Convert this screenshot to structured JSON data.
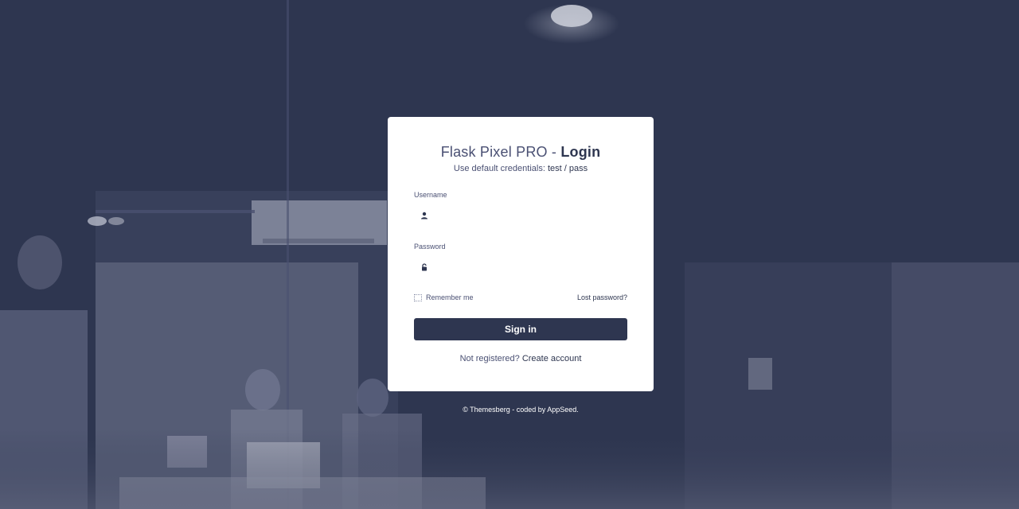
{
  "login": {
    "title_prefix": "Flask Pixel PRO - ",
    "title_strong": "Login",
    "subtitle_prefix": "Use default credentials: ",
    "subtitle_credentials": "test / pass",
    "username_label": "Username",
    "username_placeholder": "",
    "password_label": "Password",
    "password_placeholder": "",
    "remember_label": "Remember me",
    "lost_password_label": "Lost password?",
    "signin_label": "Sign in",
    "register_prompt": "Not registered? ",
    "register_link": "Create account"
  },
  "footer": {
    "copyright": "© Themesberg",
    "separator": " - coded by ",
    "author": "AppSeed",
    "end": "."
  },
  "icons": {
    "username": "user-icon",
    "password": "unlock-icon"
  },
  "colors": {
    "primary": "#2e3650",
    "text": "#4a5073",
    "card": "#ffffff"
  }
}
